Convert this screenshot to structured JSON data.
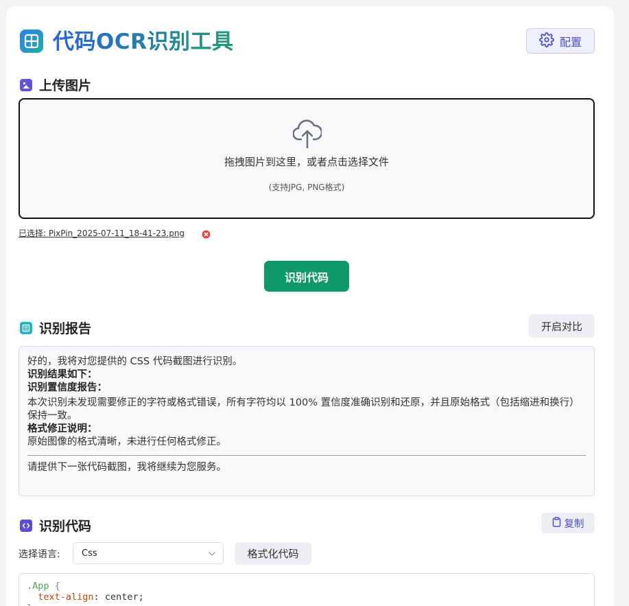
{
  "app": {
    "title": "代码OCR识别工具",
    "config_label": "配置"
  },
  "upload": {
    "heading": "上传图片",
    "drop_text": "拖拽图片到这里，或者点击选择文件",
    "hint": "(支持JPG, PNG格式)",
    "selected_file": "已选择: PixPin_2025-07-11_18-41-23.png"
  },
  "actions": {
    "recognize_label": "识别代码"
  },
  "report": {
    "heading": "识别报告",
    "compare_label": "开启对比",
    "intro": "好的，我将对您提供的 CSS 代码截图进行识别。",
    "result_title": "识别结果如下：",
    "confidence_title": "识别置信度报告：",
    "confidence_text": "本次识别未发现需要修正的字符或格式错误，所有字符均以 100% 置信度准确识别和还原，并且原始格式（包括缩进和换行）保持一致。",
    "format_title": "格式修正说明：",
    "format_text": "原始图像的格式清晰，未进行任何格式修正。",
    "closing": "请提供下一张代码截图，我将继续为您服务。"
  },
  "code": {
    "heading": "识别代码",
    "copy_label": "复制",
    "language_label": "选择语言:",
    "language_value": "Css",
    "format_label": "格式化代码",
    "line1_selector": ".App",
    "line1_brace": " {",
    "line2_indent": "  ",
    "line2_property": "text-align",
    "line2_colon": ": ",
    "line2_value": "center;",
    "line3": "}"
  },
  "colors": {
    "accent_green": "#0f9868",
    "accent_purple": "#4f4fc7",
    "title_gradient_start": "#2b63d9",
    "title_gradient_end": "#1f9a73"
  }
}
